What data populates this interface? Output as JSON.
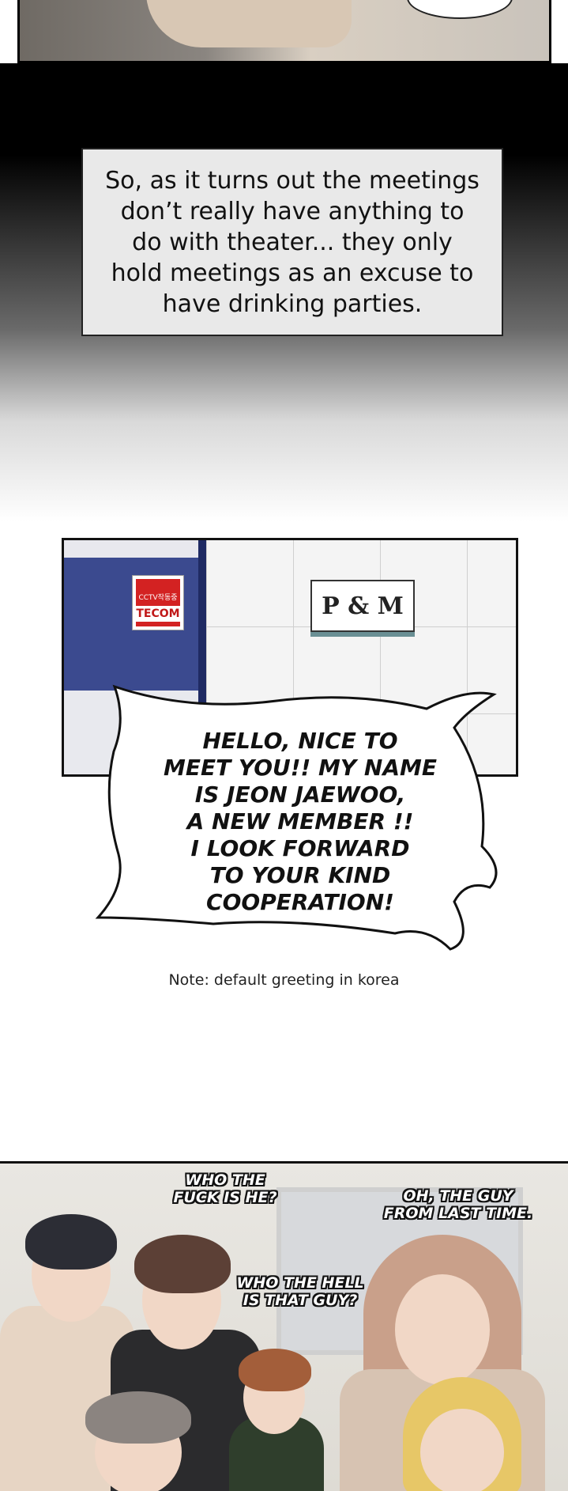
{
  "narration": {
    "text": "So, as it turns out the meetings don’t really have anything to do with theater... they only hold meetings as an excuse to have drinking parties."
  },
  "office": {
    "sign_text": "P & M",
    "cctv_label": "CCTV작동중",
    "cctv_brand": "TECOM"
  },
  "speech": {
    "text": "HELLO, NICE TO\nMEET YOU!! MY NAME\nIS JEON JAEWOO,\nA NEW MEMBER !!\nI LOOK FORWARD\nTO YOUR KIND\nCOOPERATION!"
  },
  "note": {
    "text": "Note: default greeting in korea"
  },
  "group": {
    "sfx_1": "WHO THE\nFUCK IS HE?",
    "sfx_2": "OH, THE GUY\nFROM LAST TIME.",
    "sfx_3": "WHO THE HELL\nIS THAT GUY?"
  }
}
